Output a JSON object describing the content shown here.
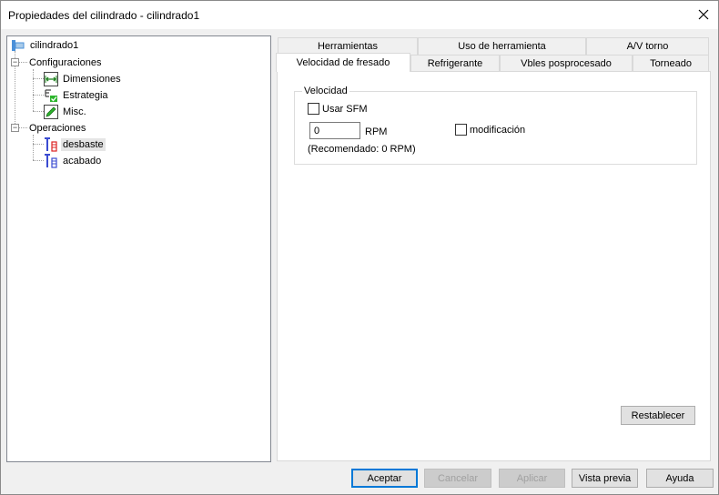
{
  "window": {
    "title": "Propiedades del cilindrado - cilindrado1"
  },
  "tree": {
    "root": "cilindrado1",
    "configuraciones": "Configuraciones",
    "dimensiones": "Dimensiones",
    "estrategia": "Estrategia",
    "misc": "Misc.",
    "operaciones": "Operaciones",
    "desbaste": "desbaste",
    "acabado": "acabado",
    "expander_symbol": "−"
  },
  "tabs": {
    "herramientas": "Herramientas",
    "uso_herramienta": "Uso de herramienta",
    "av_torno": "A/V torno",
    "velocidad_fresado": "Velocidad de fresado",
    "refrigerante": "Refrigerante",
    "vbles_posprocesado": "Vbles posprocesado",
    "torneado": "Torneado"
  },
  "velocidad": {
    "group_label": "Velocidad",
    "usar_sfm_label": "Usar SFM",
    "usar_sfm_checked": false,
    "rpm_value": "0",
    "rpm_unit": "RPM",
    "modificacion_label": "modificación",
    "modificacion_checked": false,
    "recomendado": "(Recomendado: 0 RPM)"
  },
  "buttons": {
    "restablecer": "Restablecer",
    "aceptar": "Aceptar",
    "cancelar": "Cancelar",
    "aplicar": "Aplicar",
    "vista_previa": "Vista previa",
    "ayuda": "Ayuda"
  },
  "colors": {
    "selection_bg": "#e5e5e5",
    "default_button_border": "#0078d7"
  }
}
